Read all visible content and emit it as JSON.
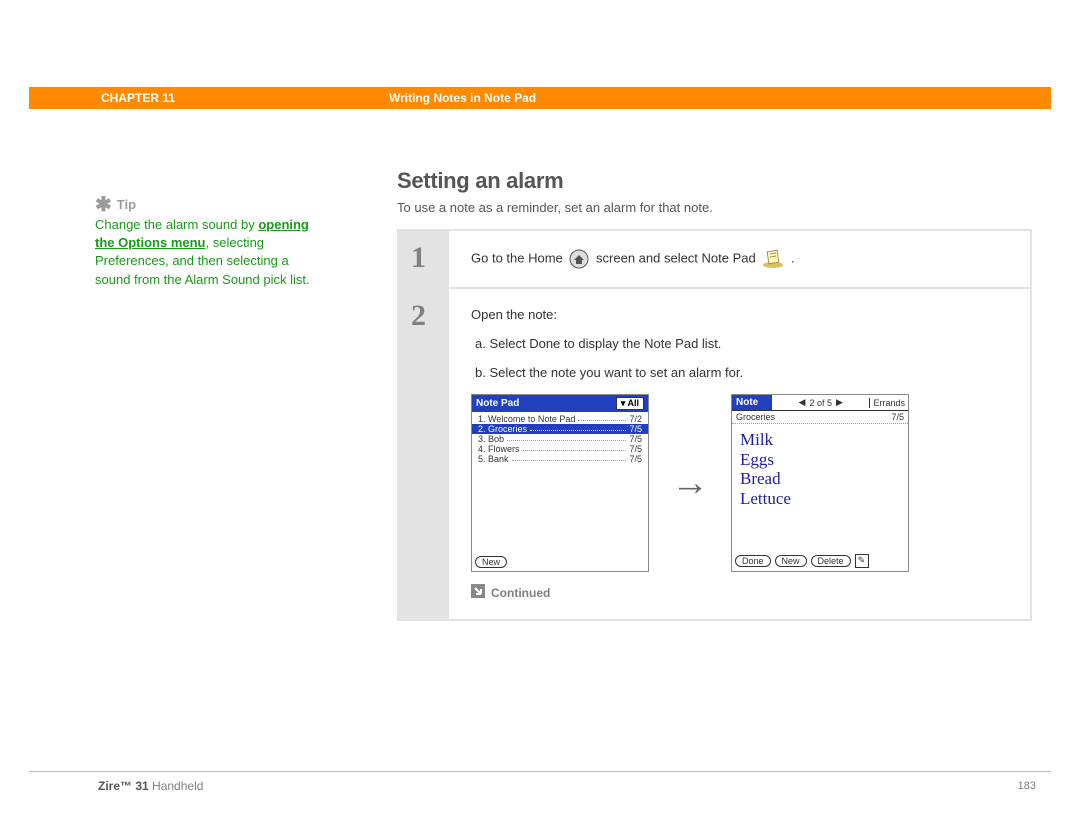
{
  "header": {
    "chapter": "CHAPTER 11",
    "title": "Writing Notes in Note Pad"
  },
  "sidebar": {
    "tip_label": "Tip",
    "tip_text_pre": "Change the alarm sound by ",
    "tip_link": "opening the Options menu",
    "tip_text_post": ", selecting Preferences, and then selecting a sound from the Alarm Sound pick list."
  },
  "main": {
    "heading": "Setting an alarm",
    "lead": "To use a note as a reminder, set an alarm for that note."
  },
  "step1": {
    "num": "1",
    "text_a": "Go to the Home",
    "text_b": "screen and select Note Pad",
    "text_c": "."
  },
  "step2": {
    "num": "2",
    "intro": "Open the note:",
    "a": "a.  Select Done to display the Note Pad list.",
    "b": "b.  Select the note you want to set an alarm for.",
    "continued": "Continued"
  },
  "screen_left": {
    "title": "Note Pad",
    "filter": "All",
    "rows": [
      {
        "idx": "1.",
        "name": "Welcome to Note Pad",
        "date": "7/2"
      },
      {
        "idx": "2.",
        "name": "Groceries",
        "date": "7/5"
      },
      {
        "idx": "3.",
        "name": "Bob",
        "date": "7/5"
      },
      {
        "idx": "4.",
        "name": "Flowers",
        "date": "7/5"
      },
      {
        "idx": "5.",
        "name": "Bank",
        "date": "7/5"
      }
    ],
    "btn_new": "New"
  },
  "screen_right": {
    "title": "Note",
    "nav": "2 of 5",
    "category": "Errands",
    "note_name": "Groceries",
    "note_date": "7/5",
    "handwriting": [
      "Milk",
      "Eggs",
      "Bread",
      "Lettuce"
    ],
    "btn_done": "Done",
    "btn_new": "New",
    "btn_delete": "Delete"
  },
  "footer": {
    "product_bold": "Zire™ 31",
    "product_rest": " Handheld",
    "page": "183"
  }
}
